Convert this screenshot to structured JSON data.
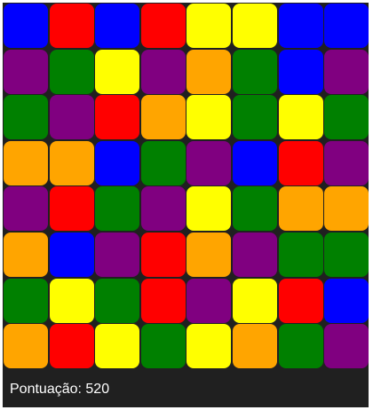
{
  "colors": {
    "blue": "#0000ff",
    "red": "#ff0000",
    "yellow": "#ffff00",
    "purple": "#800080",
    "green": "#008000",
    "orange": "#ffa500"
  },
  "board": {
    "rows": [
      [
        "blue",
        "red",
        "blue",
        "red",
        "yellow",
        "yellow",
        "blue",
        "blue"
      ],
      [
        "purple",
        "green",
        "yellow",
        "purple",
        "orange",
        "green",
        "blue",
        "purple"
      ],
      [
        "green",
        "purple",
        "red",
        "orange",
        "yellow",
        "green",
        "yellow",
        "green"
      ],
      [
        "orange",
        "orange",
        "blue",
        "green",
        "purple",
        "blue",
        "red",
        "purple"
      ],
      [
        "purple",
        "red",
        "green",
        "purple",
        "yellow",
        "green",
        "orange",
        "orange"
      ],
      [
        "orange",
        "blue",
        "purple",
        "red",
        "orange",
        "purple",
        "green",
        "green"
      ],
      [
        "green",
        "yellow",
        "green",
        "red",
        "purple",
        "yellow",
        "red",
        "blue"
      ],
      [
        "orange",
        "red",
        "yellow",
        "green",
        "yellow",
        "orange",
        "green",
        "purple"
      ]
    ]
  },
  "status": {
    "score_text": "Pontuação: 520"
  }
}
